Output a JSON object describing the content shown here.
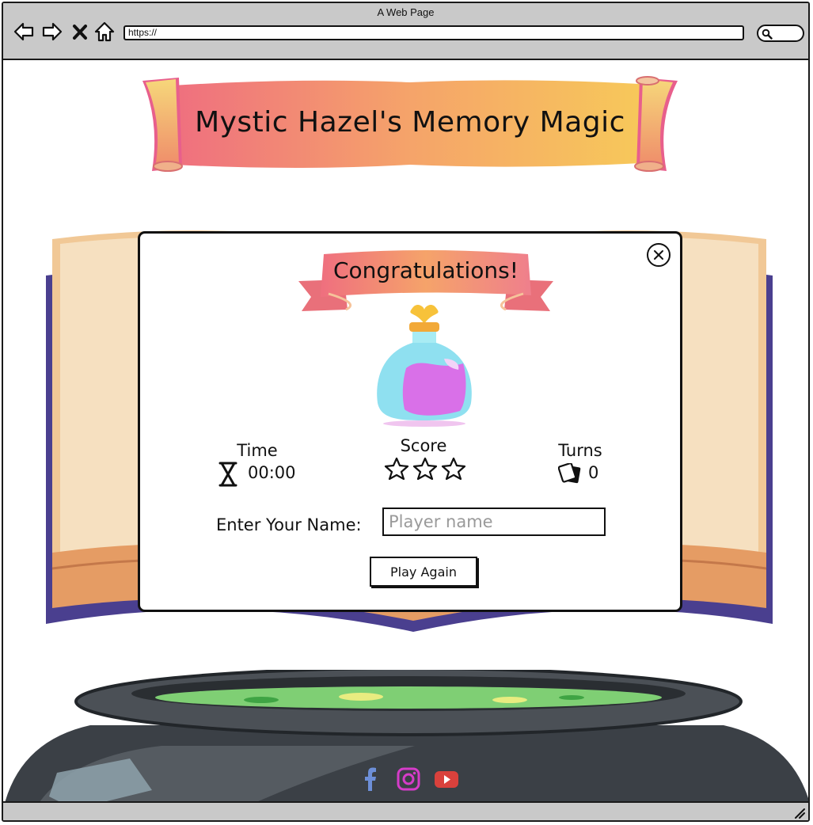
{
  "browser": {
    "window_title": "A Web Page",
    "url": "https://",
    "icons": [
      "back-arrow-icon",
      "forward-arrow-icon",
      "close-x-icon",
      "home-icon",
      "search-icon",
      "resize-grip-icon"
    ]
  },
  "page": {
    "title": "Mystic Hazel's Memory Magic"
  },
  "modal": {
    "title": "Congratulations!",
    "stats": {
      "time": {
        "label": "Time",
        "value": "00:00",
        "icon": "hourglass-icon"
      },
      "score": {
        "label": "Score",
        "stars_filled": 0,
        "stars_total": 3,
        "icon": "star-icon"
      },
      "turns": {
        "label": "Turns",
        "value": "0",
        "icon": "cards-icon"
      }
    },
    "name_label": "Enter Your Name:",
    "name_placeholder": "Player name",
    "name_value": "",
    "play_button": "Play Again"
  },
  "footer": {
    "social": [
      {
        "name": "facebook-icon",
        "color": "#6d8fd8"
      },
      {
        "name": "instagram-icon",
        "color": "#d63cc9"
      },
      {
        "name": "youtube-icon",
        "color": "#d9413c"
      }
    ]
  },
  "colors": {
    "chrome": "#c9c9c9",
    "banner_start": "#f07b7b",
    "banner_end": "#f5c253",
    "book_cover": "#4a3f8f",
    "potion_liquid": "#d970e8",
    "cauldron_liquid": "#7fcf74"
  }
}
